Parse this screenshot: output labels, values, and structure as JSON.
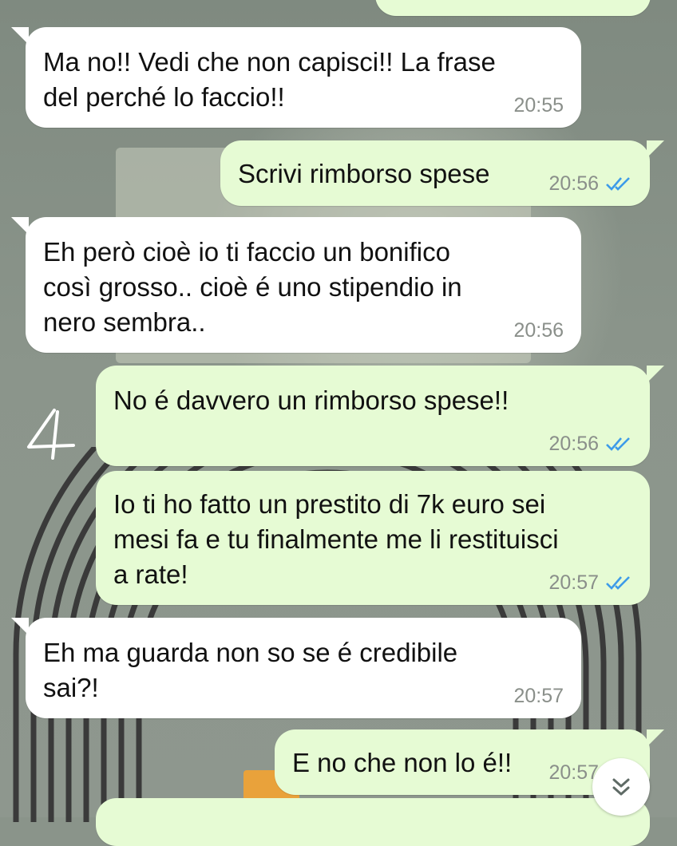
{
  "colors": {
    "incoming_bubble": "#ffffff",
    "outgoing_bubble": "#e6fbd4",
    "read_ticks": "#3d9be9",
    "timestamp": "#8a8f8a"
  },
  "messages": [
    {
      "id": "m1",
      "direction": "incoming",
      "text": "Ma no!! Vedi che non capisci!! La frase\ndel perché lo faccio!!",
      "time": "20:55"
    },
    {
      "id": "m2",
      "direction": "outgoing",
      "text": "Scrivi rimborso spese",
      "time": "20:56",
      "status": "read"
    },
    {
      "id": "m3",
      "direction": "incoming",
      "text": "Eh però cioè io ti faccio un bonifico\ncosì grosso.. cioè é uno stipendio in\nnero sembra..",
      "time": "20:56"
    },
    {
      "id": "m4",
      "direction": "outgoing",
      "text": "No é davvero un rimborso spese!!",
      "time": "20:56",
      "status": "read"
    },
    {
      "id": "m5",
      "direction": "outgoing",
      "text": "Io ti ho fatto un prestito di 7k euro sei\nmesi fa e tu finalmente me li restituisci\na rate!",
      "time": "20:57",
      "status": "read"
    },
    {
      "id": "m6",
      "direction": "incoming",
      "text": "Eh ma guarda non so se é credibile\nsai?!",
      "time": "20:57"
    },
    {
      "id": "m7",
      "direction": "outgoing",
      "text": "E no che non lo é!!",
      "time": "20:57",
      "status": "read"
    }
  ],
  "annotation": {
    "text": "4"
  },
  "controls": {
    "scroll_down_icon": "double-chevron-down-icon"
  }
}
